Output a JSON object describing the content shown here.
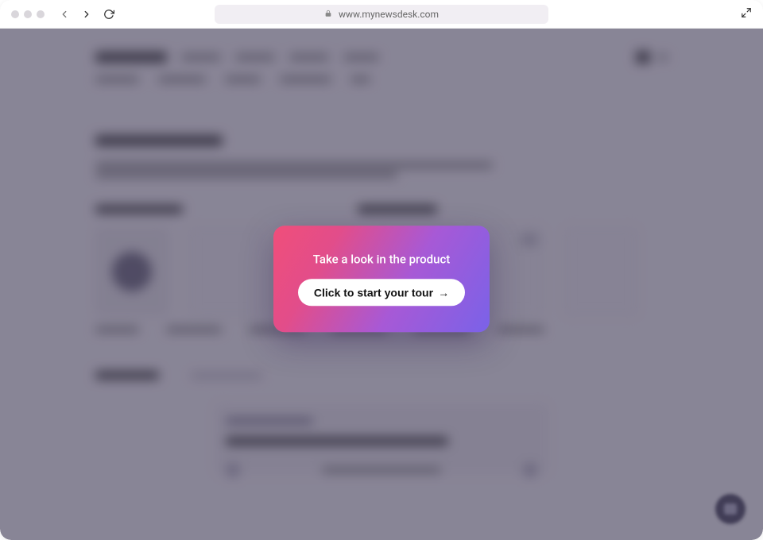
{
  "browser": {
    "url": "www.mynewsdesk.com"
  },
  "modal": {
    "title": "Take a look in the product",
    "cta_label": "Click to start your tour",
    "cta_arrow": "→"
  }
}
